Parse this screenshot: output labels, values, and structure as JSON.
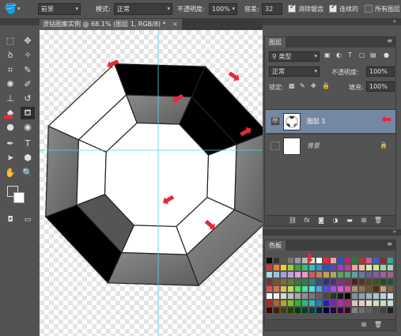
{
  "options_bar": {
    "tool_icon": "paint-bucket-icon",
    "fill_source": "前景",
    "mode_label": "模式:",
    "mode_value": "正常",
    "opacity_label": "不透明度:",
    "opacity_value": "100%",
    "tolerance_label": "容差:",
    "tolerance_value": "32",
    "antialias_label": "消除锯齿",
    "contiguous_label": "连续的",
    "all_layers_label": "所有图层",
    "antialias_checked": true,
    "contiguous_checked": true,
    "all_layers_checked": false
  },
  "document_tab": {
    "title": "烫钻图案实例 @ 68.1% (图层 1, RGB/8) *",
    "close": "×"
  },
  "toolbox": {
    "tools": [
      "marquee-icon",
      "move-icon",
      "lasso-icon",
      "magic-wand-icon",
      "crop-icon",
      "eyedropper-icon",
      "healing-icon",
      "brush-icon",
      "stamp-icon",
      "history-brush-icon",
      "eraser-icon",
      "paint-bucket-icon",
      "blur-icon",
      "dodge-icon",
      "pen-icon",
      "type-icon",
      "path-select-icon",
      "shape-icon",
      "hand-icon",
      "zoom-icon"
    ],
    "selected_tool": "paint-bucket-icon"
  },
  "layers_panel": {
    "title": "图层",
    "kind_filter": "类型",
    "blend_mode": "正常",
    "opacity_label": "不透明度:",
    "opacity_value": "100%",
    "lock_label": "锁定:",
    "fill_label": "填充:",
    "fill_value": "100%",
    "layers": [
      {
        "name": "图层 1",
        "visible": true,
        "active": true
      },
      {
        "name": "背景",
        "visible": false,
        "active": false,
        "locked": true
      }
    ],
    "footer_icons": [
      "link-icon",
      "fx-icon",
      "mask-icon",
      "adjustment-icon",
      "group-icon",
      "new-layer-icon",
      "trash-icon"
    ],
    "fx_label": "fx"
  },
  "swatches_panel": {
    "title": "色板"
  },
  "colors": {
    "foreground": "#555555",
    "background": "#ffffff",
    "accent_arrow": "#e8283a",
    "active_layer": "#7388a3",
    "guide": "#4ad7e8"
  }
}
